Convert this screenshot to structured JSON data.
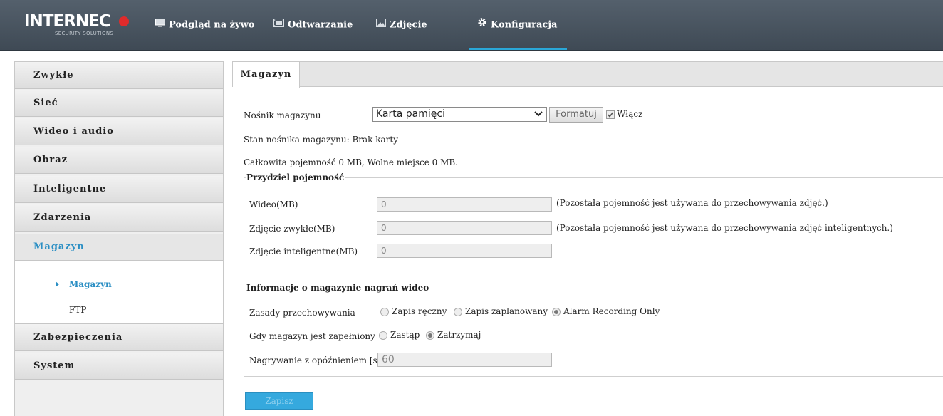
{
  "brand": {
    "logo_text": "INTERNEC",
    "logo_sub": "SECURITY SOLUTIONS",
    "accent": "#2aa7d7",
    "logo_dot_color": "#e02b2b"
  },
  "nav": {
    "items": [
      {
        "label": "Podgląd na żywo",
        "icon": "monitor-icon"
      },
      {
        "label": "Odtwarzanie",
        "icon": "film-icon"
      },
      {
        "label": "Zdjęcie",
        "icon": "picture-icon"
      },
      {
        "label": "Konfiguracja",
        "icon": "gear-icon",
        "active": true
      }
    ]
  },
  "sidebar": {
    "items": [
      {
        "label": "Zwykłe"
      },
      {
        "label": "Sieć"
      },
      {
        "label": "Wideo i audio"
      },
      {
        "label": "Obraz"
      },
      {
        "label": "Inteligentne"
      },
      {
        "label": "Zdarzenia"
      },
      {
        "label": "Magazyn",
        "active": true
      },
      {
        "label": "Zabezpieczenia"
      },
      {
        "label": "System"
      }
    ],
    "submenu": [
      {
        "label": "Magazyn",
        "active": true
      },
      {
        "label": "FTP"
      }
    ]
  },
  "main": {
    "tab": "Magazyn",
    "storage_medium_label": "Nośnik magazynu",
    "storage_medium_value": "Karta pamięci",
    "format_button": "Formatuj",
    "enable_label": "Włącz",
    "enable_checked": true,
    "status_text": "Stan nośnika magazynu:  Brak karty",
    "capacity_text": "Całkowita pojemność  0  MB,  Wolne miejsce  0  MB.",
    "allocation": {
      "legend": "Przydziel pojemność",
      "rows": [
        {
          "label": "Wideo(MB)",
          "value": "0",
          "note": "(Pozostała pojemność jest używana do przechowywania zdjęć.)"
        },
        {
          "label": "Zdjęcie zwykłe(MB)",
          "value": "0",
          "note": "(Pozostała pojemność jest używana do przechowywania zdjęć inteligentnych.)"
        },
        {
          "label": "Zdjęcie inteligentne(MB)",
          "value": "0",
          "note": ""
        }
      ]
    },
    "recording": {
      "legend": "Informacje o magazynie nagrań wideo",
      "policy_label": "Zasady przechowywania",
      "policy_options": [
        "Zapis ręczny",
        "Zapis zaplanowany",
        "Alarm Recording Only"
      ],
      "policy_selected": 2,
      "full_label": "Gdy magazyn jest zapełniony",
      "full_options": [
        "Zastąp",
        "Zatrzymaj"
      ],
      "full_selected": 1,
      "delay_label": "Nagrywanie z opóźnieniem [s]",
      "delay_value": "60"
    },
    "save_button": "Zapisz"
  }
}
